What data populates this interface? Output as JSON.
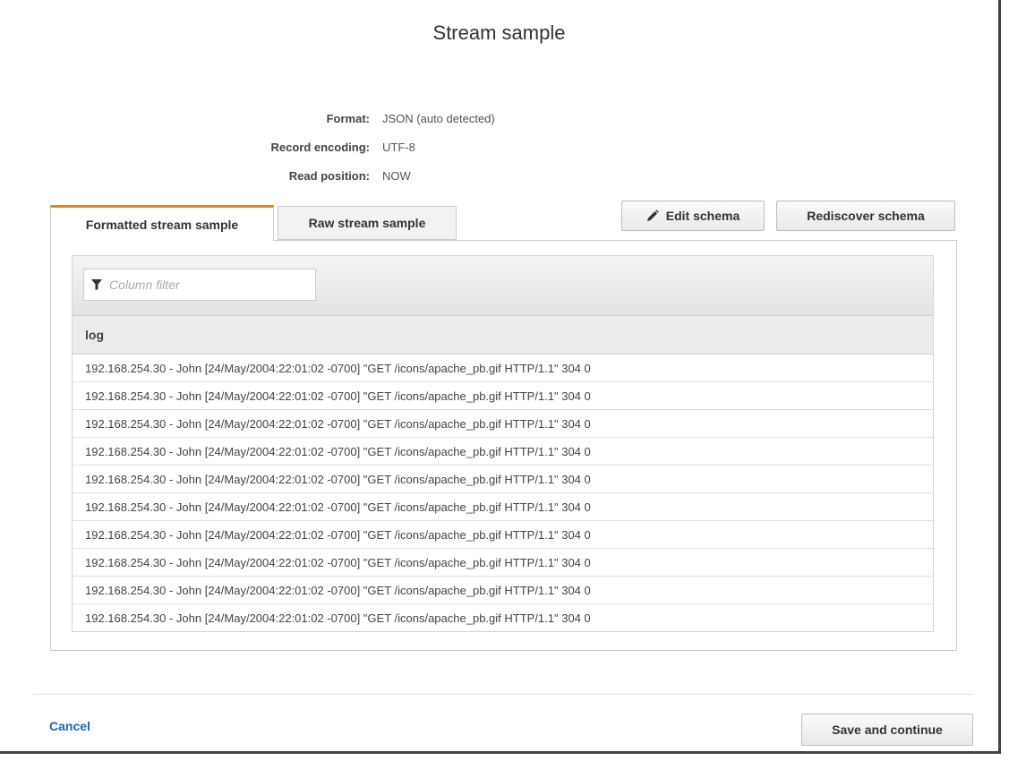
{
  "dialog": {
    "title": "Stream sample"
  },
  "properties": [
    {
      "label": "Format:",
      "value": "JSON (auto detected)"
    },
    {
      "label": "Record encoding:",
      "value": "UTF-8"
    },
    {
      "label": "Read position:",
      "value": "NOW"
    }
  ],
  "tabs": {
    "formatted": "Formatted stream sample",
    "raw": "Raw stream sample",
    "active": "formatted"
  },
  "toolbar": {
    "edit_schema": "Edit schema",
    "rediscover_schema": "Rediscover schema"
  },
  "filter": {
    "placeholder": "Column filter",
    "icon": "filter-icon"
  },
  "table": {
    "columns": [
      "log"
    ],
    "rows": [
      "192.168.254.30 - John [24/May/2004:22:01:02 -0700] \"GET /icons/apache_pb.gif HTTP/1.1\" 304 0",
      "192.168.254.30 - John [24/May/2004:22:01:02 -0700] \"GET /icons/apache_pb.gif HTTP/1.1\" 304 0",
      "192.168.254.30 - John [24/May/2004:22:01:02 -0700] \"GET /icons/apache_pb.gif HTTP/1.1\" 304 0",
      "192.168.254.30 - John [24/May/2004:22:01:02 -0700] \"GET /icons/apache_pb.gif HTTP/1.1\" 304 0",
      "192.168.254.30 - John [24/May/2004:22:01:02 -0700] \"GET /icons/apache_pb.gif HTTP/1.1\" 304 0",
      "192.168.254.30 - John [24/May/2004:22:01:02 -0700] \"GET /icons/apache_pb.gif HTTP/1.1\" 304 0",
      "192.168.254.30 - John [24/May/2004:22:01:02 -0700] \"GET /icons/apache_pb.gif HTTP/1.1\" 304 0",
      "192.168.254.30 - John [24/May/2004:22:01:02 -0700] \"GET /icons/apache_pb.gif HTTP/1.1\" 304 0",
      "192.168.254.30 - John [24/May/2004:22:01:02 -0700] \"GET /icons/apache_pb.gif HTTP/1.1\" 304 0",
      "192.168.254.30 - John [24/May/2004:22:01:02 -0700] \"GET /icons/apache_pb.gif HTTP/1.1\" 304 0"
    ]
  },
  "footer": {
    "cancel": "Cancel",
    "save": "Save and continue"
  },
  "colors": {
    "active_tab_accent": "#e8890c",
    "link": "#1a66b5"
  }
}
